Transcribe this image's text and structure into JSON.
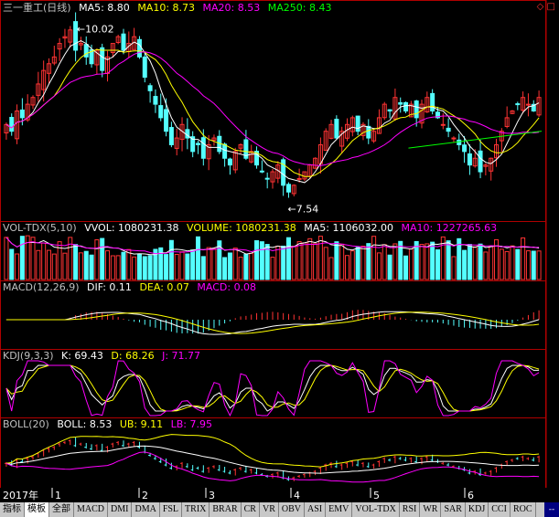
{
  "headers": {
    "main": {
      "title": "三一重工(日线)",
      "ma5": "MA5: 8.80",
      "ma10": "MA10: 8.73",
      "ma20": "MA20: 8.53",
      "ma250": "MA250: 8.43"
    },
    "vol": {
      "name": "VOL-TDX(5,10)",
      "vvol": "VVOL: 1080231.38",
      "volume": "VOLUME: 1080231.38",
      "ma5": "MA5: 1106032.00",
      "ma10": "MA10: 1227265.63"
    },
    "macd": {
      "name": "MACD(12,26,9)",
      "dif": "DIF: 0.11",
      "dea": "DEA: 0.07",
      "macd": "MACD: 0.08"
    },
    "kdj": {
      "name": "KDJ(9,3,3)",
      "k": "K: 69.43",
      "d": "D: 68.26",
      "j": "J: 71.77"
    },
    "boll": {
      "name": "BOLL(20)",
      "boll": "BOLL: 8.53",
      "ub": "UB: 9.11",
      "lb": "LB: 7.95"
    }
  },
  "colors": {
    "up": "#ff3333",
    "down": "#54ffff",
    "ma5": "#ffffff",
    "ma10": "#ffff00",
    "ma20": "#ff00ff",
    "ma250": "#00ff00",
    "axis": "#b00000",
    "label": "#c0c0c0"
  },
  "chart_data": {
    "type": "candlestick",
    "title": "三一重工(日线)",
    "annotations": {
      "high": "10.02",
      "low": "7.54"
    },
    "year_label": "2017年",
    "months": [
      "1",
      "2",
      "3",
      "4",
      "5",
      "6"
    ],
    "close_hint": [
      8.6,
      8.5,
      8.8,
      8.7,
      8.9,
      9.0,
      9.2,
      9.4,
      9.5,
      9.6,
      9.8,
      9.9,
      10.0,
      9.7,
      9.8,
      9.6,
      9.5,
      9.7,
      9.4,
      9.6,
      9.8,
      9.9,
      9.7,
      9.8,
      9.9,
      9.6,
      9.3,
      9.1,
      8.9,
      8.7,
      8.5,
      8.3,
      8.4,
      8.6,
      8.4,
      8.2,
      8.3,
      8.1,
      8.3,
      8.4,
      8.2,
      8.1,
      8.0,
      8.2,
      8.3,
      8.1,
      8.2,
      8.0,
      7.9,
      7.8,
      7.9,
      8.0,
      7.7,
      7.6,
      7.7,
      7.8,
      7.9,
      8.0,
      8.1,
      8.3,
      8.5,
      8.6,
      8.4,
      8.5,
      8.6,
      8.7,
      8.5,
      8.6,
      8.4,
      8.5,
      8.7,
      8.9,
      8.8,
      9.0,
      8.9,
      8.8,
      8.9,
      8.7,
      8.9,
      9.0,
      8.8,
      8.7,
      8.6,
      8.5,
      8.4,
      8.3,
      8.2,
      8.0,
      8.1,
      7.9,
      8.0,
      8.1,
      8.3,
      8.5,
      8.7,
      8.8,
      8.9,
      9.0,
      8.9,
      8.8,
      9.0
    ],
    "macd_summary": {
      "dif": 0.11,
      "dea": 0.07,
      "macd": 0.08
    },
    "kdj_summary": {
      "k": 69.43,
      "d": 68.26,
      "j": 71.77
    },
    "boll_summary": {
      "mid": 8.53,
      "upper": 9.11,
      "lower": 7.95
    },
    "volume_summary": {
      "volume": 1080231.38,
      "ma5": 1106032.0,
      "ma10": 1227265.63
    }
  },
  "toolbar": {
    "tabs": [
      "指标",
      "模板",
      "全部",
      "MACD",
      "DMI",
      "DMA",
      "FSL",
      "TRIX",
      "BRAR",
      "CR",
      "VR",
      "OBV",
      "ASI",
      "EMV",
      "VOL-TDX",
      "RSI",
      "WR",
      "SAR",
      "KDJ",
      "CCI",
      "ROC"
    ],
    "scroll": "--"
  }
}
